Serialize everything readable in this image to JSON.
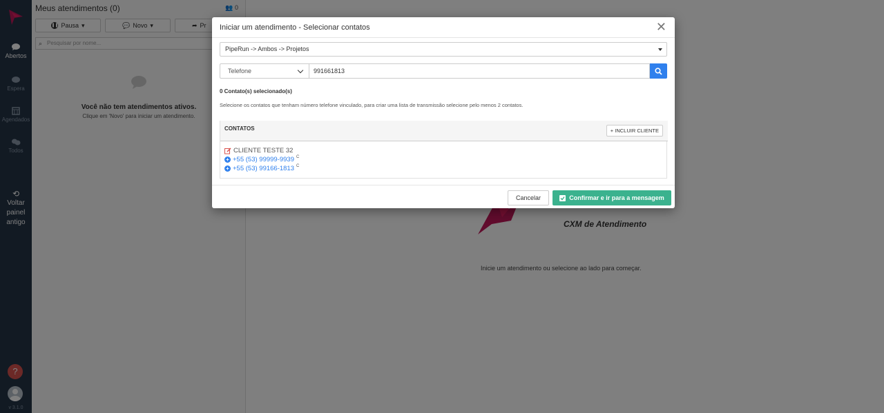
{
  "rail": {
    "items": [
      {
        "label": "Abertos",
        "icon": "chat-bubble-icon"
      },
      {
        "label": "Espera",
        "icon": "chat-bubble-icon"
      },
      {
        "label": "Agendados",
        "icon": "calendar-icon"
      },
      {
        "label": "Todos",
        "icon": "chat-bubbles-icon"
      }
    ],
    "back_label_1": "Voltar",
    "back_label_2": "painel",
    "back_label_3": "antigo",
    "help_label": "?",
    "version": "v 3.1.0"
  },
  "panel": {
    "title": "Meus atendimentos (0)",
    "count": "0",
    "buttons": {
      "pause": "Pausa",
      "new": "Novo",
      "third": "Pr"
    },
    "search_placeholder": "Pesquisar por nome...",
    "empty_title": "Você não tem atendimentos ativos.",
    "empty_sub": "Clique em 'Novo' para iniciar um atendimento."
  },
  "main": {
    "tagline": "CXM de Atendimento",
    "hint": "Inicie um atendimento ou selecione ao lado para começar."
  },
  "modal": {
    "title": "Iniciar um atendimento - Selecionar contatos",
    "close": "✕",
    "pipeline": "PipeRun -> Ambos -> Projetos",
    "search_type": "Telefone",
    "search_value": "991661813",
    "selected_count": "0 Contato(s) selecionado(s)",
    "info_text": "Selecione os contatos que tenham número telefone vinculado, para criar uma lista de transmissão selecione pelo menos 2 contatos.",
    "contacts_header": "CONTATOS",
    "add_client": "+ INCLUIR CLIENTE",
    "contact": {
      "name": "CLIENTE TESTE 32",
      "phones": [
        {
          "number": "+55 (53) 99999-9939",
          "tag": "C"
        },
        {
          "number": "+55 (53) 99166-1813",
          "tag": "C"
        }
      ]
    },
    "cancel": "Cancelar",
    "confirm": "Confirmar e ir para a mensagem"
  },
  "colors": {
    "rail_bg": "#243447",
    "primary_blue": "#2f80ed",
    "confirm_green": "#3bb28e",
    "brand_red": "#c2185b"
  }
}
